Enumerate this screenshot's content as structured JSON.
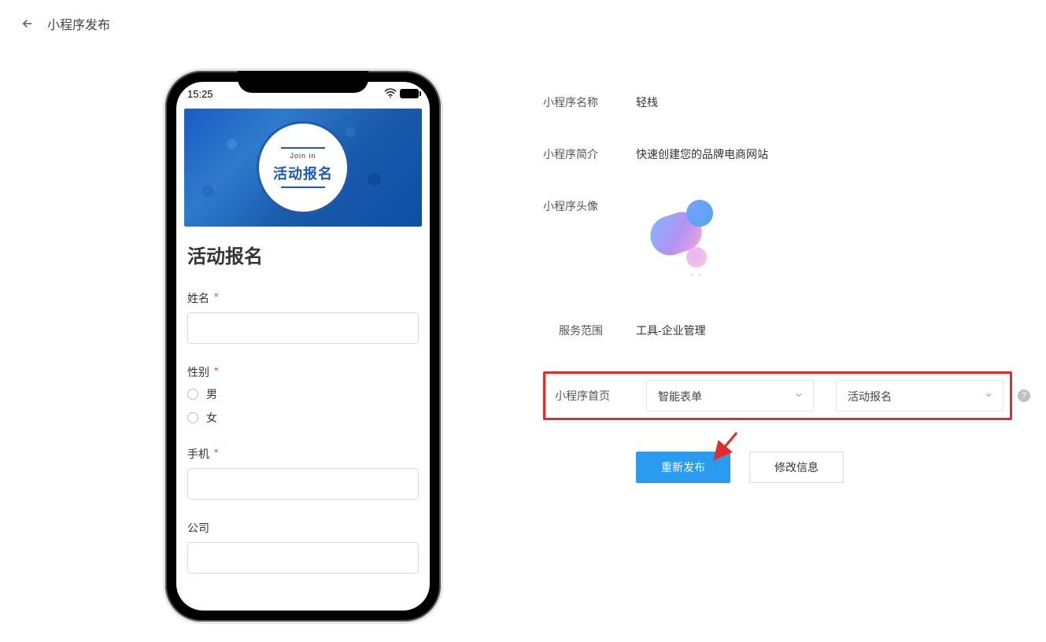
{
  "header": {
    "page_title": "小程序发布"
  },
  "phone": {
    "statusbar_time": "15:25",
    "banner_small": "Join  in",
    "banner_big": "活动报名",
    "form_title": "活动报名",
    "fields": {
      "name_label": "姓名",
      "gender_label": "性别",
      "gender_male": "男",
      "gender_female": "女",
      "phone_label": "手机",
      "company_label": "公司"
    }
  },
  "info": {
    "name_label": "小程序名称",
    "name_value": "轻栈",
    "desc_label": "小程序简介",
    "desc_value": "快速创建您的品牌电商网站",
    "avatar_label": "小程序头像",
    "scope_label": "服务范围",
    "scope_value": "工具-企业管理",
    "home_label": "小程序首页",
    "select1": "智能表单",
    "select2": "活动报名"
  },
  "actions": {
    "republish": "重新发布",
    "modify": "修改信息"
  }
}
